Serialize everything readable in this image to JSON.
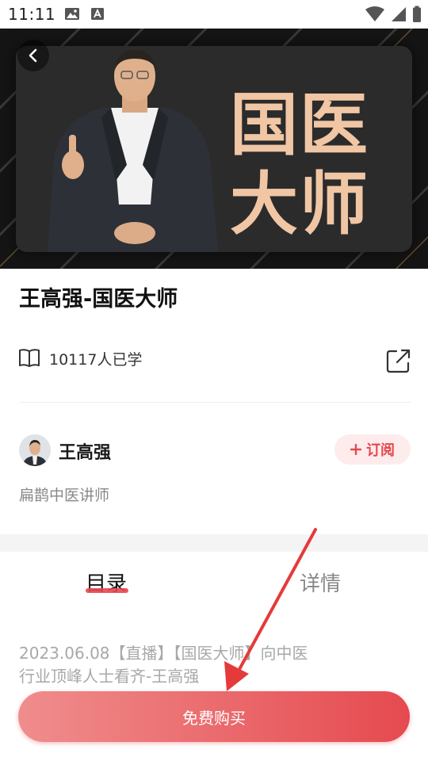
{
  "status_bar": {
    "time": "11:11"
  },
  "banner": {
    "title_line1": "国医",
    "title_line2": "大师"
  },
  "course": {
    "title": "王高强-国医大师",
    "learners": "10117人已学"
  },
  "teacher": {
    "name": "王高强",
    "description": "扁鹊中医讲师",
    "subscribe_label": "订阅"
  },
  "tabs": [
    {
      "label": "目录",
      "active": true
    },
    {
      "label": "详情",
      "active": false
    }
  ],
  "lessons": [
    {
      "title": "2023.06.08【直播】【国医大师】向中医行业顶峰人士看齐-王高强"
    }
  ],
  "footer": {
    "buy_label": "免费购买"
  },
  "colors": {
    "accent": "#e5474f",
    "banner_text": "#f0c6a4"
  }
}
